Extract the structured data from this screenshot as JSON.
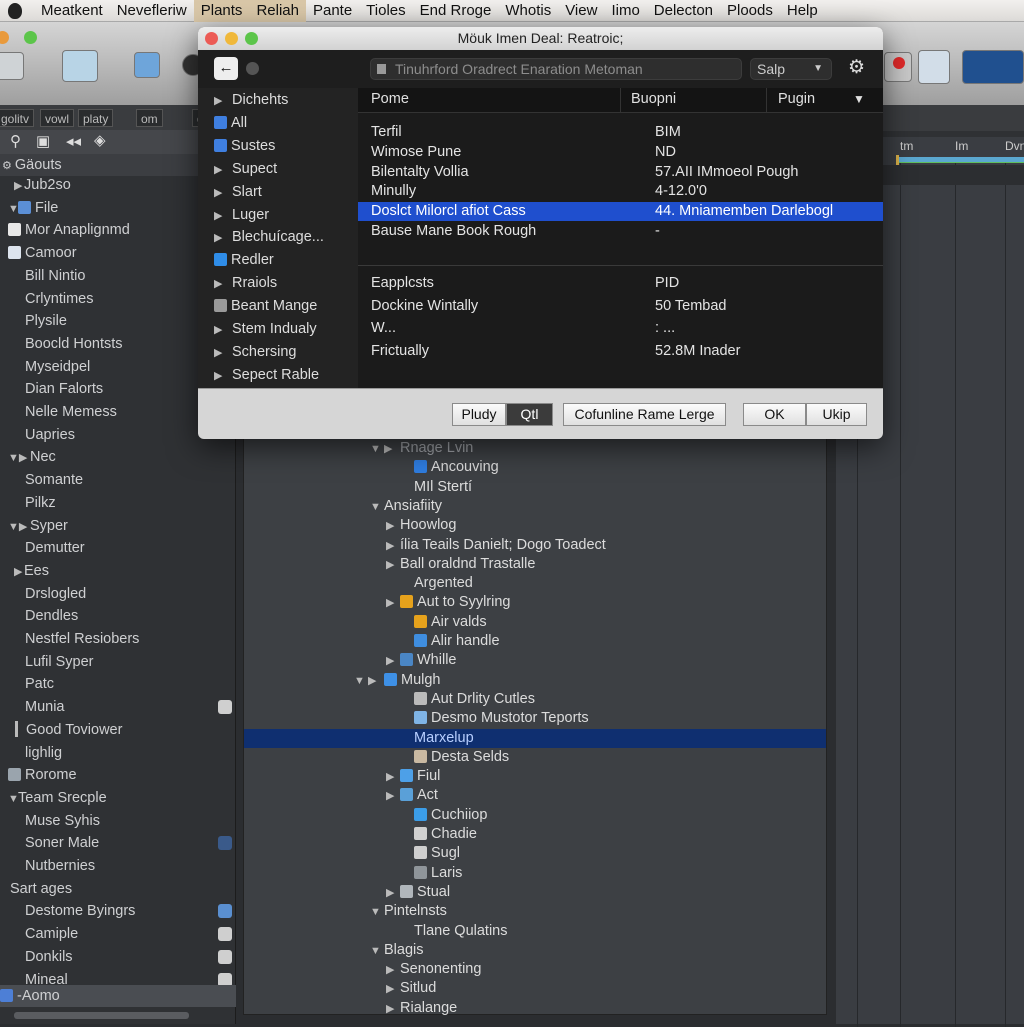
{
  "menubar": {
    "items": [
      "Meatkent",
      "Nevefleriw",
      "Plants",
      "Reliah",
      "Pante",
      "Tioles",
      "End Rroge",
      "Whotis",
      "View",
      "Iimo",
      "Delecton",
      "Ploods",
      "Help"
    ],
    "highlighted": [
      "Plants",
      "Reliah"
    ]
  },
  "filters": [
    "golitv",
    "vowl",
    "platy",
    "om",
    "gtln"
  ],
  "sidebar": {
    "header": "Gäouts",
    "items": [
      {
        "label": "Jub2so",
        "indent": 1,
        "tri": "right"
      },
      {
        "label": "File",
        "indent": 0,
        "tri": "down",
        "icon": "#5b8fd6"
      },
      {
        "label": "Mor Anaplignmd",
        "indent": 0,
        "icon": "#e8e8e8"
      },
      {
        "label": "Camoor",
        "indent": 0,
        "icon": "#dde4ee"
      },
      {
        "label": "Bill Nintio",
        "indent": 2
      },
      {
        "label": "Crlyntimes",
        "indent": 2
      },
      {
        "label": "Plysile",
        "indent": 2
      },
      {
        "label": "Boocld Hontsts",
        "indent": 2
      },
      {
        "label": "Myseidpel",
        "indent": 2
      },
      {
        "label": "Dian Falorts",
        "indent": 2
      },
      {
        "label": "Nelle Memess",
        "indent": 2
      },
      {
        "label": "Uapries",
        "indent": 2
      },
      {
        "label": "Nec",
        "indent": 0,
        "tri": "down-right"
      },
      {
        "label": "Somante",
        "indent": 2
      },
      {
        "label": "Pilkz",
        "indent": 2
      },
      {
        "label": "Syper",
        "indent": 0,
        "tri": "down-right"
      },
      {
        "label": "Demutter",
        "indent": 2
      },
      {
        "label": "Ees",
        "indent": 1,
        "tri": "right"
      },
      {
        "label": "Drslogled",
        "indent": 2
      },
      {
        "label": "Dendles",
        "indent": 2
      },
      {
        "label": "Nestfel Resiobers",
        "indent": 2
      },
      {
        "label": "Lufil Syper",
        "indent": 2
      },
      {
        "label": "Patc",
        "indent": 2
      },
      {
        "label": "Munia",
        "indent": 2,
        "right_icon": "music-icon"
      },
      {
        "label": "Good Toviower",
        "indent": 2,
        "bar": true
      },
      {
        "label": "lighlig",
        "indent": 2
      },
      {
        "label": "Rorome",
        "indent": 0,
        "icon": "#9aa4ad"
      },
      {
        "label": "Team Srecple",
        "indent": 0,
        "tri": "down"
      },
      {
        "label": "Muse Syhis",
        "indent": 2
      },
      {
        "label": "Soner Male",
        "indent": 2,
        "right_icon": "globe-icon"
      },
      {
        "label": "Nutbernies",
        "indent": 2
      },
      {
        "label": "Sart ages",
        "indent": 3
      },
      {
        "label": "Destome Byingrs",
        "indent": 2,
        "right_icon": "sync-icon"
      },
      {
        "label": "Camiple",
        "indent": 2,
        "right_icon": "document-icon"
      },
      {
        "label": "Donkils",
        "indent": 2,
        "right_icon": "image-icon"
      },
      {
        "label": "Mineal",
        "indent": 2,
        "right_icon": "window-icon"
      }
    ],
    "footer_item": "-Aomo"
  },
  "tree": [
    {
      "label": "Rnage Lvin",
      "level": 1,
      "tri": "down-right",
      "dim": true
    },
    {
      "label": "Ancouving",
      "level": 2,
      "icon": "#2f7de0"
    },
    {
      "label": "MIl Stertí",
      "level": 2
    },
    {
      "label": "Ansiafiity",
      "level": 0,
      "tri": "down"
    },
    {
      "label": "Hoowlog",
      "level": 1,
      "tri": "right"
    },
    {
      "label": "ília Teails Danielt; Dogo Toadect",
      "level": 1,
      "tri": "right"
    },
    {
      "label": "Ball oraldnd Trastalle",
      "level": 1,
      "tri": "right"
    },
    {
      "label": "Argented",
      "level": 2
    },
    {
      "label": "Aut to Syylring",
      "level": 1,
      "tri": "right",
      "icon": "#e6a21c"
    },
    {
      "label": "Air valds",
      "level": 2,
      "icon": "#e6a21c"
    },
    {
      "label": "Alir handle",
      "level": 2,
      "icon": "#3f8ee0"
    },
    {
      "label": "Whille",
      "level": 1,
      "tri": "right",
      "icon": "#4a86c5"
    },
    {
      "label": "Mulgh",
      "level": 0,
      "tri": "down-right",
      "icon": "#3e90e6"
    },
    {
      "label": "Aut Drlity Cutles",
      "level": 2,
      "icon": "#bbbbbb"
    },
    {
      "label": "Desmo Mustotor Teports",
      "level": 2,
      "icon": "#7fb4e6"
    },
    {
      "label": "Marxelup",
      "level": 2,
      "selected": true
    },
    {
      "label": "Desta Selds",
      "level": 2,
      "icon": "#c9b9a2"
    },
    {
      "label": "Fiul",
      "level": 1,
      "tri": "right",
      "icon": "#4da0e8"
    },
    {
      "label": "Act",
      "level": 1,
      "tri": "right",
      "icon": "#5aa0d8"
    },
    {
      "label": "Cuchiiop",
      "level": 2,
      "icon": "#3b9de8"
    },
    {
      "label": "Chadie",
      "level": 2,
      "icon": "#d0d0d0"
    },
    {
      "label": "Sugl",
      "level": 2,
      "icon": "#cfcfcf"
    },
    {
      "label": "Laris",
      "level": 2,
      "icon": "#8f959a"
    },
    {
      "label": "Stual",
      "level": 1,
      "tri": "right",
      "icon": "#b0b6bb"
    },
    {
      "label": "Pintelnsts",
      "level": 0,
      "tri": "down"
    },
    {
      "label": "Tlane Qulatins",
      "level": 2
    },
    {
      "label": "Blagis",
      "level": 0,
      "tri": "down"
    },
    {
      "label": "Senonenting",
      "level": 1,
      "tri": "right"
    },
    {
      "label": "Sitlud",
      "level": 1,
      "tri": "right"
    },
    {
      "label": "Rialange",
      "level": 1,
      "tri": "right"
    }
  ],
  "timeline": {
    "labels": [
      "tm",
      "Im",
      "Dvn"
    ],
    "accent": "#5ba8d0"
  },
  "dialog": {
    "title": "Möuk Imen Deal: Reatroic;",
    "search_placeholder": "Tinuhrford Oradrect Enaration  Metoman",
    "dropdown": "Salp",
    "sidebar": [
      {
        "label": "Dichehts",
        "icon": "tri"
      },
      {
        "label": "All",
        "icon": "#3f7fe0"
      },
      {
        "label": "Sustes",
        "icon": "#3f7fe0"
      },
      {
        "label": "Supect",
        "icon": "tri"
      },
      {
        "label": "Slart",
        "icon": "tri"
      },
      {
        "label": "Luger",
        "icon": "tri"
      },
      {
        "label": "Blechuícage...",
        "icon": "tri"
      },
      {
        "label": "Redler",
        "icon": "#2f8de8"
      },
      {
        "label": "Rraiols",
        "icon": "tri"
      },
      {
        "label": "Beant Mange",
        "icon": "#9a9a9a"
      },
      {
        "label": "Stem Indualy",
        "icon": "tri"
      },
      {
        "label": "Schersing",
        "icon": "tri"
      },
      {
        "label": "Sepect Rable",
        "icon": "tri"
      }
    ],
    "columns": [
      "Pome",
      "Buopni",
      "Pugin"
    ],
    "rows": [
      [
        "Terfil",
        "BIM"
      ],
      [
        "Wimose Pune",
        "ND"
      ],
      [
        "Bilentalty Vollia",
        "57.AII IMmoeol Pough"
      ],
      [
        "Minully",
        "4-12.0'0"
      ],
      [
        "Doslct Milorcl afiot Cass",
        "44. Mniamemben Darlebogl"
      ],
      [
        "Bause Mane Book Rough",
        "-"
      ]
    ],
    "selected_row": 4,
    "rows2": [
      [
        "Eapplcsts",
        "PID"
      ],
      [
        "Dockine Wintally",
        "50 Tembad"
      ],
      [
        "W...",
        ": ..."
      ],
      [
        "Frictually",
        "52.8M Inader"
      ]
    ],
    "buttons_left": [
      "Pludy",
      "Qtl",
      "Cofunline Rame Lerge"
    ],
    "buttons_right": [
      "OK",
      "Ukip"
    ],
    "selection_color": "#1f4fce"
  }
}
